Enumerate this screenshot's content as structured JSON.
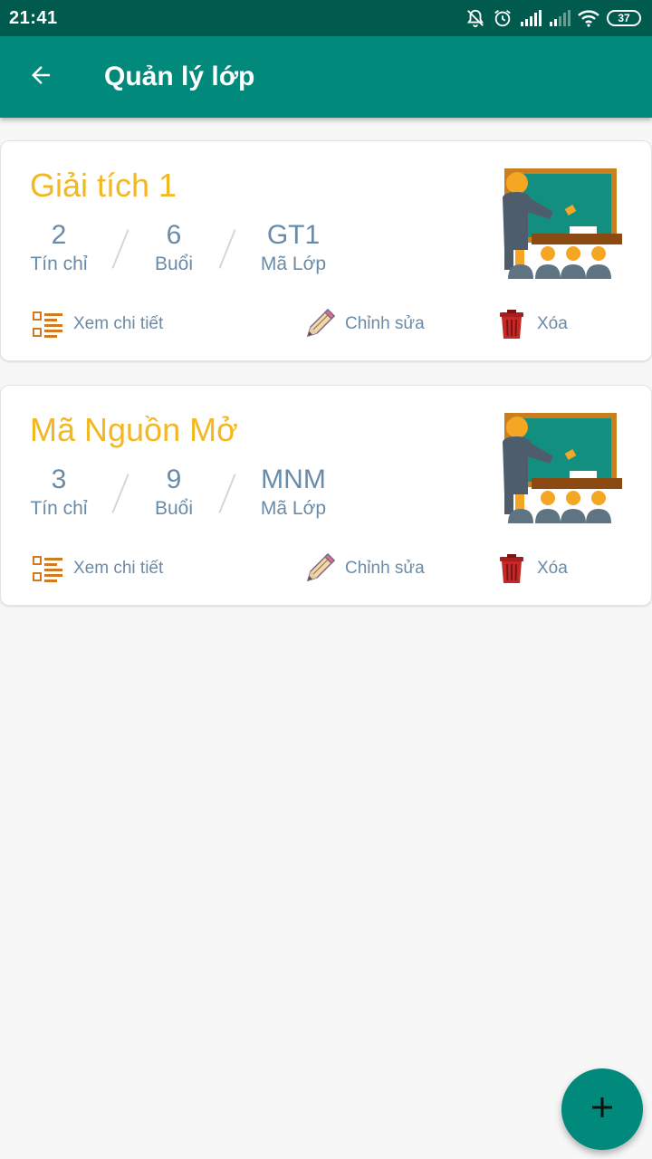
{
  "status_bar": {
    "time": "21:41",
    "battery": "37",
    "icons": [
      "mute-bell-icon",
      "alarm-icon",
      "signal-icon",
      "signal-weak-icon",
      "wifi-icon",
      "battery-icon"
    ]
  },
  "app_bar": {
    "title": "Quản lý lớp",
    "back_icon": "arrow-left-icon"
  },
  "classes": [
    {
      "name": "Giải tích 1",
      "credits": "2",
      "credits_label": "Tín chỉ",
      "sessions": "6",
      "sessions_label": "Buổi",
      "code": "GT1",
      "code_label": "Mã Lớp",
      "actions": {
        "detail": "Xem chi tiết",
        "edit": "Chỉnh sửa",
        "delete": "Xóa"
      }
    },
    {
      "name": "Mã Nguồn Mở",
      "credits": "3",
      "credits_label": "Tín chỉ",
      "sessions": "9",
      "sessions_label": "Buổi",
      "code": "MNM",
      "code_label": "Mã Lớp",
      "actions": {
        "detail": "Xem chi tiết",
        "edit": "Chỉnh sửa",
        "delete": "Xóa"
      }
    }
  ],
  "fab": {
    "icon": "plus-icon"
  },
  "colors": {
    "primary": "#01897b",
    "primary_dark": "#005a4d",
    "title_accent": "#f2b721",
    "text_muted": "#6a8ba8",
    "background": "#f7f7f7"
  }
}
